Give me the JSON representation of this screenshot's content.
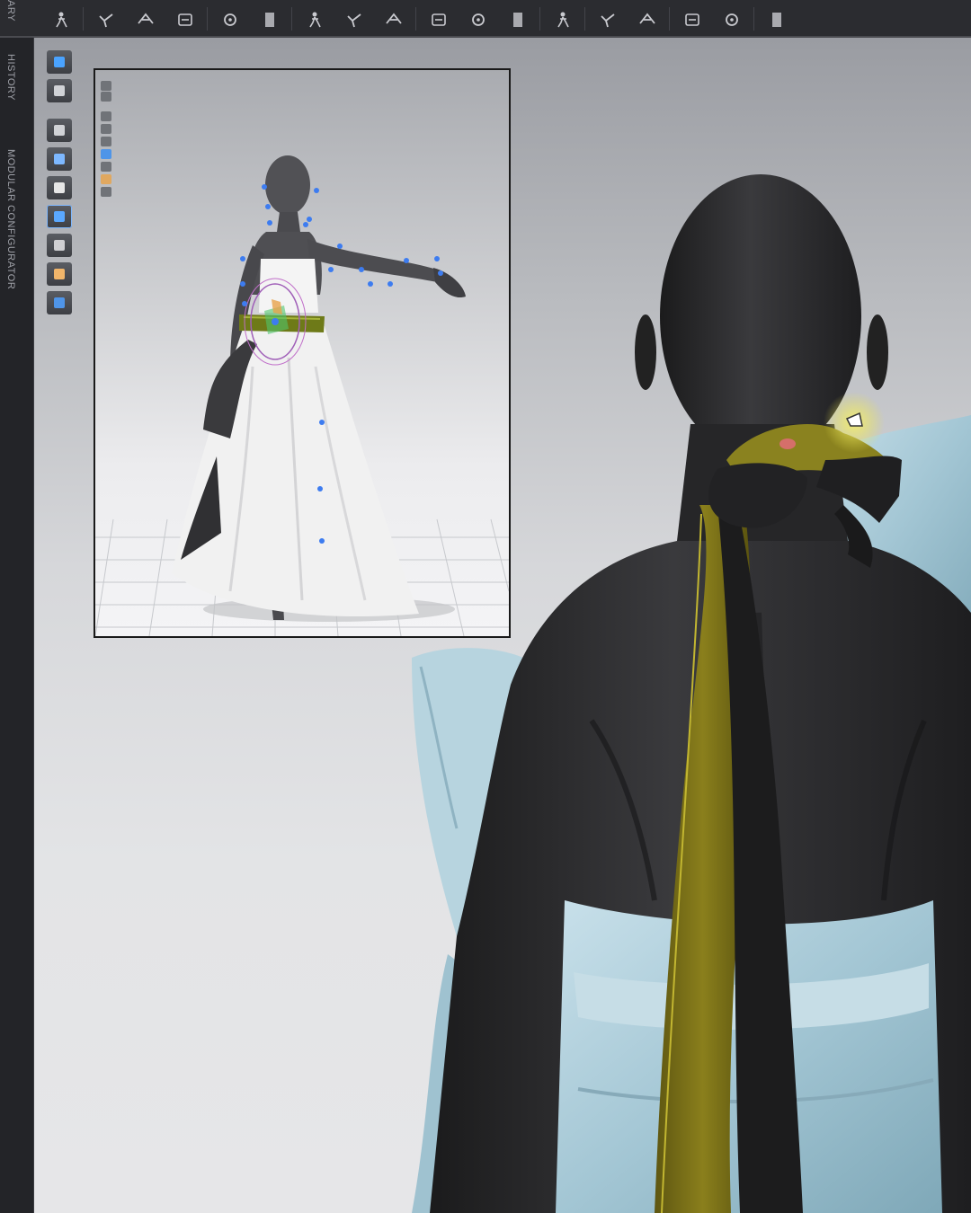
{
  "toolbar": {
    "buttons": [
      {
        "name": "fit-avatar-icon"
      },
      {
        "name": "arrange-points-icon"
      },
      {
        "name": "arrange-plane-icon"
      },
      {
        "name": "reset-arrangement-icon"
      },
      {
        "name": "pin-tool-icon"
      },
      {
        "name": "sewing-tool-icon"
      },
      {
        "name": "tack-tool-icon"
      },
      {
        "name": "fold-tool-icon"
      },
      {
        "name": "shirring-tool-icon"
      },
      {
        "name": "button-tool-icon"
      },
      {
        "name": "buttonhole-tool-icon"
      },
      {
        "name": "lock-button-icon"
      },
      {
        "name": "zipper-tool-icon"
      },
      {
        "name": "topstitch-tool-icon"
      },
      {
        "name": "fabric-swatch-icon"
      },
      {
        "name": "trim-tool-icon"
      },
      {
        "name": "texture-swatch-icon"
      },
      {
        "name": "measure-tool-icon"
      }
    ]
  },
  "side_tabs": {
    "library": "ARY",
    "history": "HISTORY",
    "modular": "MODULAR CONFIGURATOR"
  },
  "viewport_tools": [
    {
      "name": "garment-display-icon",
      "active": false
    },
    {
      "name": "shirt-display-icon",
      "active": false
    },
    {
      "name": "avatar-display-icon",
      "active": false
    },
    {
      "name": "show-arrangement-icon",
      "active": false
    },
    {
      "name": "show-avatar-icon",
      "active": false
    },
    {
      "name": "simulation-mode-icon",
      "active": true
    },
    {
      "name": "texture-mode-icon",
      "active": false
    },
    {
      "name": "skin-display-icon",
      "active": false
    },
    {
      "name": "environment-icon",
      "active": false
    }
  ],
  "preview_tools": [
    {
      "name": "preview-view-icon-1"
    },
    {
      "name": "preview-view-icon-2"
    },
    {
      "name": "preview-view-icon-3"
    },
    {
      "name": "preview-view-icon-4"
    },
    {
      "name": "preview-view-icon-5"
    },
    {
      "name": "preview-view-icon-6"
    },
    {
      "name": "preview-view-icon-7"
    },
    {
      "name": "preview-view-icon-8"
    },
    {
      "name": "preview-view-icon-9"
    }
  ],
  "colors": {
    "avatar": "#2c2c2e",
    "dress_blue": "#a9cbd8",
    "dress_white": "#f3f3f3",
    "ribbon_olive": "#7a7018",
    "ribbon_dark": "#1c1c1c",
    "arrangement_point": "#3d7cf0",
    "highlight_yellow": "#e8e24a"
  }
}
